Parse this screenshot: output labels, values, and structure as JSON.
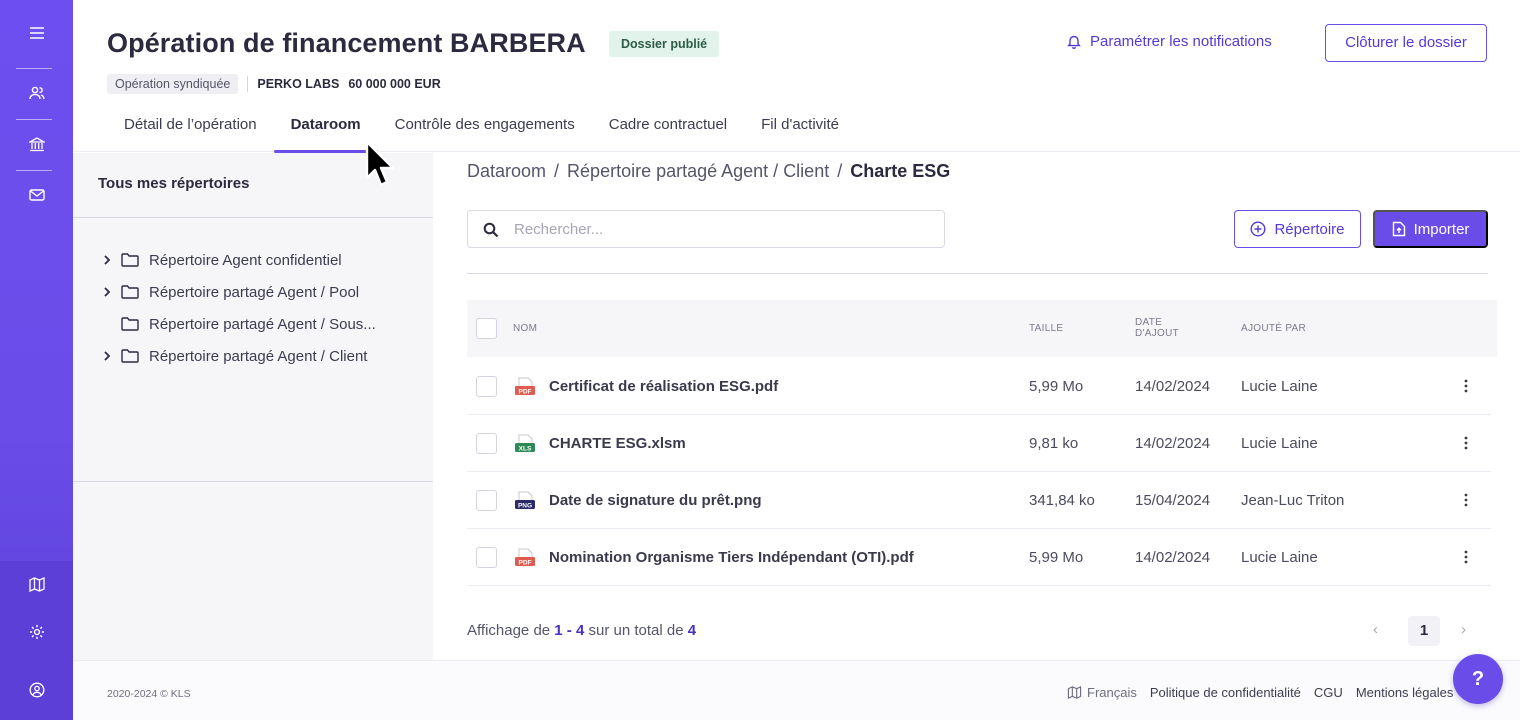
{
  "header": {
    "title": "Opération de financement BARBERA",
    "status_badge": "Dossier publié",
    "notifications_label": "Paramétrer les notifications",
    "close_button": "Clôturer le dossier",
    "operation_tag": "Opération syndiquée",
    "company": "PERKO LABS",
    "amount": "60 000 000 EUR"
  },
  "tabs": [
    {
      "label": "Détail de l’opération",
      "active": false
    },
    {
      "label": "Dataroom",
      "active": true
    },
    {
      "label": "Contrôle des engagements",
      "active": false
    },
    {
      "label": "Cadre contractuel",
      "active": false
    },
    {
      "label": "Fil d'activité",
      "active": false
    }
  ],
  "sidebar": {
    "icons": [
      "menu-icon",
      "users-icon",
      "bank-icon",
      "mail-icon",
      "map-icon",
      "gear-icon",
      "user-circle-icon"
    ]
  },
  "tree": {
    "title": "Tous mes répertoires",
    "items": [
      {
        "label": "Répertoire Agent confidentiel",
        "expandable": true
      },
      {
        "label": "Répertoire partagé Agent / Pool",
        "expandable": true
      },
      {
        "label": "Répertoire partagé Agent / Sous...",
        "expandable": false
      },
      {
        "label": "Répertoire partagé Agent / Client",
        "expandable": true
      }
    ]
  },
  "breadcrumb": {
    "root": "Dataroom",
    "middle": "Répertoire partagé Agent / Client",
    "current": "Charte ESG"
  },
  "search": {
    "placeholder": "Rechercher...",
    "value": ""
  },
  "actions": {
    "folder_button": "Répertoire",
    "import_button": "Importer"
  },
  "table": {
    "headers": {
      "name": "NOM",
      "size": "TAILLE",
      "date_line1": "DATE",
      "date_line2": "D'AJOUT",
      "added_by": "AJOUTÉ PAR"
    },
    "rows": [
      {
        "name": "Certificat de réalisation ESG.pdf",
        "type": "PDF",
        "size": "5,99 Mo",
        "date": "14/02/2024",
        "added_by": "Lucie Laine"
      },
      {
        "name": "CHARTE ESG.xlsm",
        "type": "XLS",
        "size": "9,81 ko",
        "date": "14/02/2024",
        "added_by": "Lucie Laine"
      },
      {
        "name": "Date de signature du prêt.png",
        "type": "PNG",
        "size": "341,84 ko",
        "date": "15/04/2024",
        "added_by": "Jean-Luc Triton"
      },
      {
        "name": "Nomination Organisme Tiers Indépendant (OTI).pdf",
        "type": "PDF",
        "size": "5,99 Mo",
        "date": "14/02/2024",
        "added_by": "Lucie Laine"
      }
    ]
  },
  "pagination": {
    "prefix": "Affichage de",
    "range": "1 - 4",
    "middle": "sur un total de",
    "total": "4",
    "current_page": "1",
    "prev": "‹",
    "next": "›"
  },
  "footer": {
    "copyright": "2020-2024 © KLS",
    "language": "Français",
    "privacy": "Politique de confidentialité",
    "terms": "CGU",
    "legal": "Mentions légales"
  },
  "help_label": "?",
  "colors": {
    "accent": "#6a4de8",
    "badge_bg": "#e2f3ec",
    "pdf": "#e05a4f",
    "xls": "#2e8b57",
    "png": "#2b2a6b"
  }
}
